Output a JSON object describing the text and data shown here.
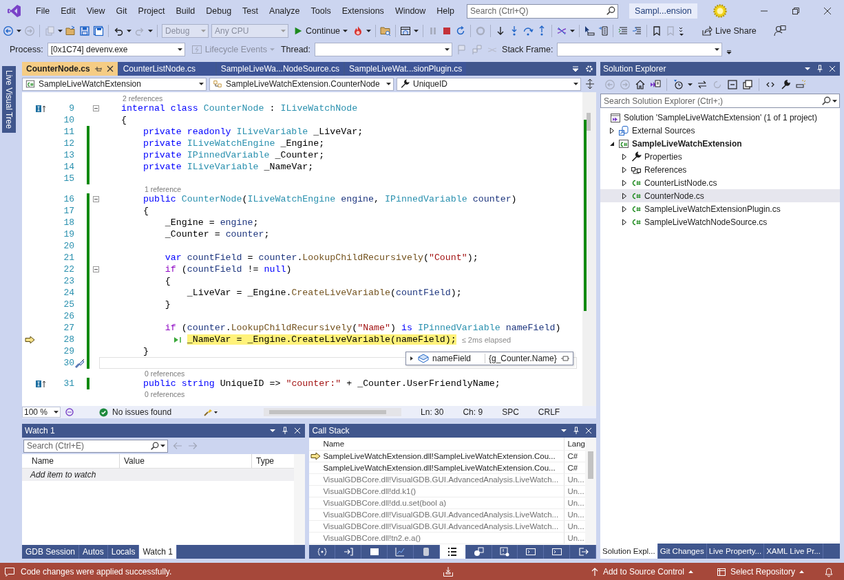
{
  "menu": [
    "File",
    "Edit",
    "View",
    "Git",
    "Project",
    "Build",
    "Debug",
    "Test",
    "Analyze",
    "Tools",
    "Extensions",
    "Window",
    "Help"
  ],
  "search": {
    "placeholder": "Search (Ctrl+Q)"
  },
  "solution_badge": "Sampl...ension",
  "toolbar": {
    "configuration": "Debug",
    "platform": "Any CPU",
    "continue": "Continue",
    "live_share": "Live Share"
  },
  "debug_location": {
    "process_label": "Process:",
    "process": "[0x1C74] devenv.exe",
    "lifecycle": "Lifecycle Events",
    "thread_label": "Thread:",
    "stack_frame_label": "Stack Frame:"
  },
  "side_tab": "Live Visual Tree",
  "editor": {
    "tabs": [
      {
        "label": "CounterNode.cs",
        "selected": true
      },
      {
        "label": "CounterListNode.cs",
        "selected": false
      },
      {
        "label": "SampleLiveWa...NodeSource.cs",
        "selected": false
      },
      {
        "label": "SampleLiveWat...sionPlugin.cs",
        "selected": false
      }
    ],
    "nav": {
      "project": "SampleLiveWatchExtension",
      "type": "SampleLiveWatchExtension.CounterNode",
      "member": "UniqueID"
    },
    "lines": [
      {
        "kind": "lens",
        "text": "2 references"
      },
      {
        "kind": "code",
        "number": "9",
        "changed": false,
        "fold": true,
        "caret": false,
        "implements": true,
        "current": false,
        "quick_actions": false,
        "tokens": [
          {
            "kind": "keyword",
            "text": "internal class "
          },
          {
            "kind": "type",
            "text": "CounterNode"
          },
          {
            "kind": "plain",
            "text": " : "
          },
          {
            "kind": "type",
            "text": "ILiveWatchNode"
          }
        ]
      },
      {
        "kind": "code",
        "number": "10",
        "changed": false,
        "fold": false,
        "caret": false,
        "implements": false,
        "current": false,
        "quick_actions": false,
        "tokens": [
          {
            "kind": "plain",
            "text": "{"
          }
        ]
      },
      {
        "kind": "code",
        "number": "11",
        "changed": true,
        "fold": false,
        "caret": false,
        "implements": false,
        "current": false,
        "quick_actions": false,
        "tokens": [
          {
            "kind": "keyword",
            "text": "    private readonly "
          },
          {
            "kind": "type",
            "text": "ILiveVariable"
          },
          {
            "kind": "plain",
            "text": " _LiveVar;"
          }
        ]
      },
      {
        "kind": "code",
        "number": "12",
        "changed": true,
        "fold": false,
        "caret": false,
        "implements": false,
        "current": false,
        "quick_actions": false,
        "tokens": [
          {
            "kind": "keyword",
            "text": "    private "
          },
          {
            "kind": "type",
            "text": "ILiveWatchEngine"
          },
          {
            "kind": "plain",
            "text": " _Engine;"
          }
        ]
      },
      {
        "kind": "code",
        "number": "13",
        "changed": true,
        "fold": false,
        "caret": false,
        "implements": false,
        "current": false,
        "quick_actions": false,
        "tokens": [
          {
            "kind": "keyword",
            "text": "    private "
          },
          {
            "kind": "type",
            "text": "IPinnedVariable"
          },
          {
            "kind": "plain",
            "text": " _Counter;"
          }
        ]
      },
      {
        "kind": "code",
        "number": "14",
        "changed": true,
        "fold": false,
        "caret": false,
        "implements": false,
        "current": false,
        "quick_actions": false,
        "tokens": [
          {
            "kind": "keyword",
            "text": "    private "
          },
          {
            "kind": "type",
            "text": "ILiveVariable"
          },
          {
            "kind": "plain",
            "text": " _NameVar;"
          }
        ]
      },
      {
        "kind": "code",
        "number": "15",
        "changed": true,
        "fold": false,
        "caret": false,
        "implements": false,
        "current": false,
        "quick_actions": false
      },
      {
        "kind": "lens",
        "text": "1 reference"
      },
      {
        "kind": "code",
        "number": "16",
        "changed": true,
        "fold": true,
        "caret": false,
        "implements": false,
        "current": false,
        "quick_actions": false,
        "tokens": [
          {
            "kind": "keyword",
            "text": "    public "
          },
          {
            "kind": "type",
            "text": "CounterNode"
          },
          {
            "kind": "plain",
            "text": "("
          },
          {
            "kind": "type",
            "text": "ILiveWatchEngine"
          },
          {
            "kind": "local",
            "text": " engine"
          },
          {
            "kind": "plain",
            "text": ", "
          },
          {
            "kind": "type",
            "text": "IPinnedVariable"
          },
          {
            "kind": "local",
            "text": " counter"
          },
          {
            "kind": "plain",
            "text": ")"
          }
        ]
      },
      {
        "kind": "code",
        "number": "17",
        "changed": true,
        "fold": false,
        "caret": false,
        "implements": false,
        "current": false,
        "quick_actions": false,
        "tokens": [
          {
            "kind": "plain",
            "text": "    {"
          }
        ]
      },
      {
        "kind": "code",
        "number": "18",
        "changed": true,
        "fold": false,
        "caret": false,
        "implements": false,
        "current": false,
        "quick_actions": false,
        "tokens": [
          {
            "kind": "plain",
            "text": "        _Engine = "
          },
          {
            "kind": "local",
            "text": "engine"
          },
          {
            "kind": "plain",
            "text": ";"
          }
        ]
      },
      {
        "kind": "code",
        "number": "19",
        "changed": true,
        "fold": false,
        "caret": false,
        "implements": false,
        "current": false,
        "quick_actions": false,
        "tokens": [
          {
            "kind": "plain",
            "text": "        _Counter = "
          },
          {
            "kind": "local",
            "text": "counter"
          },
          {
            "kind": "plain",
            "text": ";"
          }
        ]
      },
      {
        "kind": "code",
        "number": "20",
        "changed": true,
        "fold": false,
        "caret": false,
        "implements": false,
        "current": false,
        "quick_actions": false
      },
      {
        "kind": "code",
        "number": "21",
        "changed": true,
        "fold": false,
        "caret": false,
        "implements": false,
        "current": false,
        "quick_actions": false,
        "tokens": [
          {
            "kind": "keyword",
            "text": "        var "
          },
          {
            "kind": "local",
            "text": "countField"
          },
          {
            "kind": "plain",
            "text": " = "
          },
          {
            "kind": "local",
            "text": "counter"
          },
          {
            "kind": "plain",
            "text": "."
          },
          {
            "kind": "method",
            "text": "LookupChildRecursively"
          },
          {
            "kind": "plain",
            "text": "("
          },
          {
            "kind": "string",
            "text": "\"Count\""
          },
          {
            "kind": "plain",
            "text": ");"
          }
        ]
      },
      {
        "kind": "code",
        "number": "22",
        "changed": true,
        "fold": true,
        "caret": false,
        "implements": false,
        "current": false,
        "quick_actions": false,
        "tokens": [
          {
            "kind": "control",
            "text": "        if"
          },
          {
            "kind": "plain",
            "text": " ("
          },
          {
            "kind": "local",
            "text": "countField"
          },
          {
            "kind": "plain",
            "text": " != "
          },
          {
            "kind": "keyword",
            "text": "null"
          },
          {
            "kind": "plain",
            "text": ")"
          }
        ]
      },
      {
        "kind": "code",
        "number": "23",
        "changed": true,
        "fold": false,
        "caret": false,
        "implements": false,
        "current": false,
        "quick_actions": false,
        "tokens": [
          {
            "kind": "plain",
            "text": "        {"
          }
        ]
      },
      {
        "kind": "code",
        "number": "24",
        "changed": true,
        "fold": false,
        "caret": false,
        "implements": false,
        "current": false,
        "quick_actions": false,
        "tokens": [
          {
            "kind": "plain",
            "text": "            _LiveVar = _Engine."
          },
          {
            "kind": "method",
            "text": "CreateLiveVariable"
          },
          {
            "kind": "plain",
            "text": "("
          },
          {
            "kind": "local",
            "text": "countField"
          },
          {
            "kind": "plain",
            "text": ");"
          }
        ]
      },
      {
        "kind": "code",
        "number": "25",
        "changed": true,
        "fold": false,
        "caret": false,
        "implements": false,
        "current": false,
        "quick_actions": false,
        "tokens": [
          {
            "kind": "plain",
            "text": "        }"
          }
        ]
      },
      {
        "kind": "code",
        "number": "26",
        "changed": true,
        "fold": false,
        "caret": false,
        "implements": false,
        "current": false,
        "quick_actions": false
      },
      {
        "kind": "code",
        "number": "27",
        "changed": true,
        "fold": false,
        "caret": false,
        "implements": false,
        "current": false,
        "quick_actions": false,
        "tokens": [
          {
            "kind": "control",
            "text": "        if"
          },
          {
            "kind": "plain",
            "text": " ("
          },
          {
            "kind": "local",
            "text": "counter"
          },
          {
            "kind": "plain",
            "text": "."
          },
          {
            "kind": "method",
            "text": "LookupChildRecursively"
          },
          {
            "kind": "plain",
            "text": "("
          },
          {
            "kind": "string",
            "text": "\"Name\""
          },
          {
            "kind": "plain",
            "text": ") "
          },
          {
            "kind": "keyword",
            "text": "is "
          },
          {
            "kind": "type",
            "text": "IPinnedVariable"
          },
          {
            "kind": "local",
            "text": " nameField"
          },
          {
            "kind": "plain",
            "text": ")"
          }
        ]
      },
      {
        "kind": "code",
        "number": "28",
        "changed": true,
        "fold": false,
        "caret": false,
        "implements": false,
        "current": true,
        "quick_actions": false,
        "hint": "≤ 2ms elapsed",
        "tokens": [
          {
            "kind": "plain",
            "text": "            _NameVar = _Engine.CreateLiveVariable(nameField);"
          }
        ]
      },
      {
        "kind": "code",
        "number": "29",
        "changed": true,
        "fold": false,
        "caret": false,
        "implements": false,
        "current": false,
        "quick_actions": false,
        "tokens": [
          {
            "kind": "plain",
            "text": "    }"
          }
        ]
      },
      {
        "kind": "code",
        "number": "30",
        "changed": true,
        "fold": false,
        "caret": true,
        "implements": false,
        "current": false,
        "quick_actions": true
      },
      {
        "kind": "lens",
        "text": "0 references"
      },
      {
        "kind": "code",
        "number": "31",
        "changed": true,
        "fold": false,
        "caret": false,
        "implements": true,
        "current": false,
        "quick_actions": false,
        "tokens": [
          {
            "kind": "keyword",
            "text": "    public string "
          },
          {
            "kind": "plain",
            "text": "UniqueID => "
          },
          {
            "kind": "string",
            "text": "\"counter:\""
          },
          {
            "kind": "plain",
            "text": " + _Counter.UserFriendlyName;"
          }
        ]
      },
      {
        "kind": "lens",
        "text": "0 references"
      }
    ],
    "datatip": {
      "name": "nameField",
      "value": "{g_Counter.Name}"
    },
    "status": {
      "zoom": "100 %",
      "issues": "No issues found",
      "line": "Ln: 30",
      "column": "Ch: 9",
      "whitespace": "SPC",
      "line_endings": "CRLF"
    }
  },
  "watch": {
    "title": "Watch 1",
    "search_placeholder": "Search (Ctrl+E)",
    "columns": [
      "Name",
      "Value",
      "Type"
    ],
    "add_item": "Add item to watch",
    "tabs": [
      {
        "label": "GDB Session",
        "selected": false
      },
      {
        "label": "Autos",
        "selected": false
      },
      {
        "label": "Locals",
        "selected": false
      },
      {
        "label": "Watch 1",
        "selected": true
      }
    ]
  },
  "call_stack": {
    "title": "Call Stack",
    "columns": [
      "Name",
      "Lang"
    ],
    "rows": [
      {
        "name": "SampleLiveWatchExtension.dll!SampleLiveWatchExtension.Cou...",
        "lang": "C#",
        "current": true,
        "external": false
      },
      {
        "name": "SampleLiveWatchExtension.dll!SampleLiveWatchExtension.Cou...",
        "lang": "C#",
        "current": false,
        "external": false
      },
      {
        "name": "VisualGDBCore.dll!VisualGDB.GUI.AdvancedAnalysis.LiveWatch...",
        "lang": "Un...",
        "current": false,
        "external": true
      },
      {
        "name": "VisualGDBCore.dll!dd.k1()",
        "lang": "Un...",
        "current": false,
        "external": true
      },
      {
        "name": "VisualGDBCore.dll!dd.u.set(bool a)",
        "lang": "Un...",
        "current": false,
        "external": true
      },
      {
        "name": "VisualGDBCore.dll!VisualGDB.GUI.AdvancedAnalysis.LiveWatch...",
        "lang": "Un...",
        "current": false,
        "external": true
      },
      {
        "name": "VisualGDBCore.dll!VisualGDB.GUI.AdvancedAnalysis.LiveWatch...",
        "lang": "Un...",
        "current": false,
        "external": true
      },
      {
        "name": "VisualGDBCore.dll!tn2.e.a()",
        "lang": "Un...",
        "current": false,
        "external": true
      }
    ],
    "tool_tabs": [
      {
        "selected": false
      },
      {
        "selected": false
      },
      {
        "selected": false
      },
      {
        "selected": false
      },
      {
        "selected": false
      },
      {
        "selected": true
      },
      {
        "selected": false
      },
      {
        "selected": false
      },
      {
        "selected": false
      },
      {
        "selected": false
      },
      {
        "selected": false
      }
    ]
  },
  "solution_explorer": {
    "title": "Solution Explorer",
    "search_placeholder": "Search Solution Explorer (Ctrl+;)",
    "tree": [
      {
        "label": "Solution 'SampleLiveWatchExtension' (1 of 1 project)",
        "kind": "solution",
        "selected": false,
        "children": [
          {
            "label": "External Sources",
            "kind": "external",
            "expanded": false,
            "selected": false
          },
          {
            "label": "SampleLiveWatchExtension",
            "kind": "project",
            "expanded": true,
            "selected": false,
            "children": [
              {
                "label": "Properties",
                "kind": "properties",
                "expanded": false,
                "selected": false
              },
              {
                "label": "References",
                "kind": "references",
                "expanded": false,
                "selected": false
              },
              {
                "label": "CounterListNode.cs",
                "kind": "file",
                "expanded": false,
                "selected": false
              },
              {
                "label": "CounterNode.cs",
                "kind": "file",
                "expanded": false,
                "selected": true
              },
              {
                "label": "SampleLiveWatchExtensionPlugin.cs",
                "kind": "file",
                "expanded": false,
                "selected": false
              },
              {
                "label": "SampleLiveWatchNodeSource.cs",
                "kind": "file",
                "expanded": false,
                "selected": false
              }
            ]
          }
        ]
      }
    ],
    "tabs": [
      {
        "label": "Solution Expl...",
        "selected": true
      },
      {
        "label": "Git Changes",
        "selected": false
      },
      {
        "label": "Live Property...",
        "selected": false
      },
      {
        "label": "XAML Live Pr...",
        "selected": false
      }
    ]
  },
  "status_bar": {
    "message": "Code changes were applied successfully.",
    "source_control": "Add to Source Control",
    "repository": "Select Repository"
  }
}
